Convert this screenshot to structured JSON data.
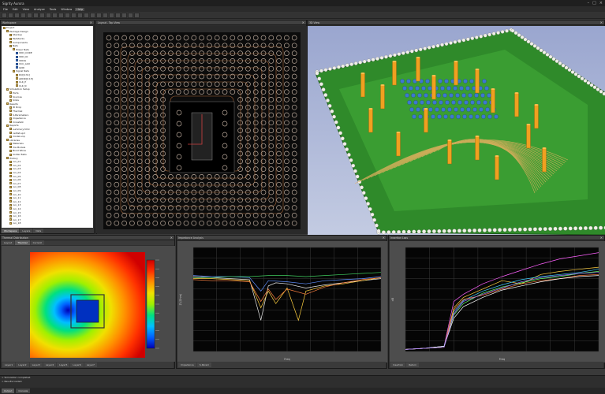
{
  "window": {
    "title": "Sigrity Aurora",
    "controls": [
      "–",
      "□",
      "×"
    ]
  },
  "menu": [
    "File",
    "Edit",
    "View",
    "Analyze",
    "Tools",
    "Window",
    "Help"
  ],
  "menu_active_index": 6,
  "tree": {
    "title": "Workspace",
    "bottom_tabs": [
      "Workspace",
      "Layers",
      "Nets"
    ],
    "rows": [
      {
        "label": "Project",
        "indent": 0,
        "blue": false
      },
      {
        "label": "Package Design",
        "indent": 1,
        "blue": false
      },
      {
        "label": "Stackup",
        "indent": 2,
        "blue": false
      },
      {
        "label": "Padstacks",
        "indent": 2,
        "blue": false
      },
      {
        "label": "Components",
        "indent": 2,
        "blue": false
      },
      {
        "label": "Nets",
        "indent": 2,
        "blue": false
      },
      {
        "label": "Power Nets",
        "indent": 3,
        "blue": false
      },
      {
        "label": "VDD_CORE",
        "indent": 4,
        "blue": true
      },
      {
        "label": "VDD_IO",
        "indent": 4,
        "blue": true
      },
      {
        "label": "VDDQ",
        "indent": 4,
        "blue": true
      },
      {
        "label": "VCC_AUX",
        "indent": 4,
        "blue": true
      },
      {
        "label": "GND",
        "indent": 4,
        "blue": true
      },
      {
        "label": "Signal Nets",
        "indent": 3,
        "blue": false
      },
      {
        "label": "DQ[0:31]",
        "indent": 4,
        "blue": false
      },
      {
        "label": "ADDR[0:15]",
        "indent": 4,
        "blue": false
      },
      {
        "label": "CLK_P",
        "indent": 4,
        "blue": false
      },
      {
        "label": "CLK_N",
        "indent": 4,
        "blue": false
      },
      {
        "label": "Simulation Setup",
        "indent": 1,
        "blue": false
      },
      {
        "label": "Ports",
        "indent": 2,
        "blue": false
      },
      {
        "label": "Sources",
        "indent": 2,
        "blue": false
      },
      {
        "label": "Sinks",
        "indent": 2,
        "blue": false
      },
      {
        "label": "Results",
        "indent": 1,
        "blue": false
      },
      {
        "label": "IR Drop",
        "indent": 2,
        "blue": false
      },
      {
        "label": "Thermal",
        "indent": 2,
        "blue": false
      },
      {
        "label": "S-Parameters",
        "indent": 2,
        "blue": false
      },
      {
        "label": "Impedance",
        "indent": 2,
        "blue": false
      },
      {
        "label": "Crosstalk",
        "indent": 2,
        "blue": false
      },
      {
        "label": "Reports",
        "indent": 1,
        "blue": false
      },
      {
        "label": "summary.html",
        "indent": 2,
        "blue": false
      },
      {
        "label": "netlist.spd",
        "indent": 2,
        "blue": false
      },
      {
        "label": "model.snp",
        "indent": 2,
        "blue": false
      },
      {
        "label": "Libraries",
        "indent": 1,
        "blue": false
      },
      {
        "label": "Materials",
        "indent": 2,
        "blue": false
      },
      {
        "label": "Via Models",
        "indent": 2,
        "blue": false
      },
      {
        "label": "Bond Wires",
        "indent": 2,
        "blue": false
      },
      {
        "label": "Solder Balls",
        "indent": 2,
        "blue": false
      },
      {
        "label": "History",
        "indent": 1,
        "blue": false
      },
      {
        "label": "run_01",
        "indent": 2,
        "blue": false
      },
      {
        "label": "run_02",
        "indent": 2,
        "blue": false
      },
      {
        "label": "run_03",
        "indent": 2,
        "blue": false
      },
      {
        "label": "run_04",
        "indent": 2,
        "blue": false
      },
      {
        "label": "run_05",
        "indent": 2,
        "blue": false
      },
      {
        "label": "run_06",
        "indent": 2,
        "blue": false
      },
      {
        "label": "run_07",
        "indent": 2,
        "blue": false
      },
      {
        "label": "run_08",
        "indent": 2,
        "blue": false
      },
      {
        "label": "run_09",
        "indent": 2,
        "blue": false
      },
      {
        "label": "run_10",
        "indent": 2,
        "blue": false
      },
      {
        "label": "run_11",
        "indent": 2,
        "blue": false
      },
      {
        "label": "run_12",
        "indent": 2,
        "blue": false
      },
      {
        "label": "run_13",
        "indent": 2,
        "blue": false
      },
      {
        "label": "run_14",
        "indent": 2,
        "blue": false
      },
      {
        "label": "run_15",
        "indent": 2,
        "blue": false
      },
      {
        "label": "run_16",
        "indent": 2,
        "blue": false
      },
      {
        "label": "run_17",
        "indent": 2,
        "blue": false
      },
      {
        "label": "run_18",
        "indent": 2,
        "blue": false
      }
    ]
  },
  "pcb_view": {
    "title": "Layout - Top View"
  },
  "view_3d": {
    "title": "3D View"
  },
  "heatmap": {
    "title": "Thermal Distribution",
    "tabs": [
      "Layout",
      "Thermal",
      "Current"
    ],
    "footer_tabs": [
      "Layer1",
      "Layer2",
      "Layer3",
      "Layer4",
      "Layer5",
      "Layer6",
      "Layer7"
    ],
    "colors": [
      "#0000b4",
      "#0060ff",
      "#00c0ff",
      "#00e080",
      "#a0f000",
      "#f0e000",
      "#ff9000",
      "#ff3000",
      "#d00000"
    ]
  },
  "chart_left": {
    "title": "Impedance Analysis",
    "footer_tabs": [
      "Impedance",
      "S-Param"
    ],
    "xlabel": "Freq",
    "ylabel": "Z (Ohm)"
  },
  "chart_right": {
    "title": "Insertion Loss",
    "footer_tabs": [
      "Insertion",
      "Return"
    ],
    "xlabel": "Freq",
    "ylabel": "dB"
  },
  "chart_data": [
    {
      "type": "line",
      "xlim": [
        0,
        10
      ],
      "ylim": [
        0,
        10
      ],
      "grid": true,
      "series": [
        {
          "color": "#e8e8e8",
          "x": [
            0,
            1,
            2,
            3,
            3.6,
            4,
            4.4,
            5,
            6,
            7,
            8,
            9,
            10
          ],
          "y": [
            7.2,
            7.1,
            7.0,
            6.9,
            3.0,
            6.3,
            6.6,
            6.5,
            6.1,
            6.4,
            6.6,
            6.8,
            7.0
          ]
        },
        {
          "color": "#ffd040",
          "x": [
            0,
            1,
            2,
            3,
            3.6,
            4,
            4.4,
            5,
            5.6,
            6,
            7,
            8,
            9,
            10
          ],
          "y": [
            7.0,
            7.0,
            6.9,
            6.8,
            4.2,
            5.8,
            4.6,
            6.1,
            3.0,
            5.8,
            6.3,
            6.5,
            6.8,
            7.1
          ]
        },
        {
          "color": "#ff8040",
          "x": [
            0,
            1,
            2,
            3,
            3.6,
            4,
            4.4,
            5,
            6,
            7,
            8,
            9,
            10
          ],
          "y": [
            6.9,
            6.8,
            6.8,
            6.7,
            4.8,
            6.0,
            5.0,
            6.0,
            5.5,
            6.2,
            6.6,
            6.9,
            7.1
          ]
        },
        {
          "color": "#6090ff",
          "x": [
            0,
            1,
            2,
            3,
            3.6,
            4,
            5,
            6,
            7,
            8,
            9,
            10
          ],
          "y": [
            7.3,
            7.2,
            7.2,
            7.1,
            5.8,
            6.8,
            6.7,
            6.5,
            6.8,
            6.9,
            7.0,
            7.2
          ]
        },
        {
          "color": "#40d060",
          "x": [
            0,
            1,
            2,
            3,
            4,
            5,
            6,
            7,
            8,
            9,
            10
          ],
          "y": [
            7.1,
            7.1,
            7.2,
            7.2,
            7.3,
            7.3,
            7.2,
            7.3,
            7.4,
            7.5,
            7.6
          ]
        }
      ]
    },
    {
      "type": "line",
      "xlim": [
        0,
        10
      ],
      "ylim": [
        0,
        10
      ],
      "grid": true,
      "series": [
        {
          "color": "#ff60ff",
          "x": [
            0,
            1,
            2,
            2.5,
            3,
            4,
            5,
            6,
            7,
            8,
            9,
            10
          ],
          "y": [
            0.2,
            0.3,
            0.5,
            4.8,
            5.5,
            6.5,
            7.2,
            7.8,
            8.4,
            8.9,
            9.2,
            9.5
          ]
        },
        {
          "color": "#ffd040",
          "x": [
            0,
            1,
            2,
            2.5,
            3,
            4,
            5,
            6,
            7,
            8,
            9,
            10
          ],
          "y": [
            0.2,
            0.3,
            0.4,
            4.2,
            5.2,
            6.0,
            6.8,
            6.5,
            7.4,
            7.7,
            7.9,
            8.1
          ]
        },
        {
          "color": "#40d0ff",
          "x": [
            0,
            1,
            2,
            2.5,
            3,
            4,
            5,
            6,
            7,
            8,
            9,
            10
          ],
          "y": [
            0.2,
            0.3,
            0.5,
            3.8,
            4.9,
            5.8,
            6.4,
            6.9,
            7.2,
            7.4,
            7.6,
            7.9
          ]
        },
        {
          "color": "#60ff60",
          "x": [
            0,
            1,
            2,
            2.5,
            3,
            4,
            5,
            6,
            7,
            8,
            9,
            10
          ],
          "y": [
            0.2,
            0.3,
            0.4,
            3.5,
            4.6,
            5.6,
            6.2,
            6.6,
            7.0,
            7.2,
            7.5,
            7.7
          ]
        },
        {
          "color": "#ff8040",
          "x": [
            0,
            1,
            2,
            2.5,
            3,
            4,
            5,
            6,
            7,
            8,
            9,
            10
          ],
          "y": [
            0.2,
            0.3,
            0.4,
            4.0,
            5.0,
            5.4,
            6.0,
            6.5,
            6.8,
            7.0,
            7.3,
            7.4
          ]
        },
        {
          "color": "#ffffff",
          "x": [
            0,
            1,
            2,
            2.5,
            3,
            4,
            5,
            6,
            7,
            8,
            9,
            10
          ],
          "y": [
            0.2,
            0.3,
            0.5,
            3.2,
            4.3,
            5.2,
            5.9,
            6.3,
            6.7,
            7.0,
            7.2,
            7.3
          ]
        },
        {
          "color": "#a070ff",
          "x": [
            0,
            1,
            2,
            2.5,
            3,
            4,
            5,
            6,
            7,
            8,
            9,
            10
          ],
          "y": [
            0.2,
            0.3,
            0.4,
            3.6,
            4.8,
            5.5,
            6.1,
            6.7,
            7.1,
            7.3,
            7.5,
            7.6
          ]
        }
      ]
    }
  ],
  "output": {
    "lines": [
      "> Simulation completed.",
      "> Results loaded."
    ]
  },
  "statusbar": {
    "tabs": [
      "Output",
      "Console"
    ]
  }
}
